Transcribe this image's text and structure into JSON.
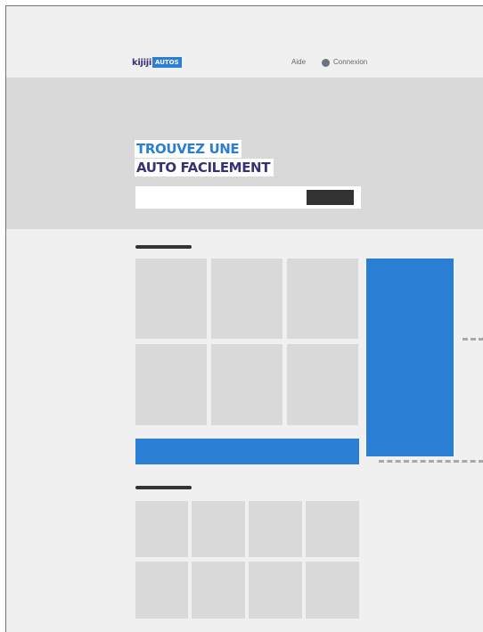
{
  "header": {
    "logo": {
      "brand": "kijiji",
      "product": "AUTOS"
    },
    "nav": {
      "help_label": "Aide",
      "login_label": "Connexion",
      "login_icon": "user-dot-icon"
    }
  },
  "hero": {
    "headline_line1": "TROUVEZ UNE",
    "headline_line2": "AUTO FACILEMENT"
  },
  "colors": {
    "brand_blue": "#2a7fd4",
    "brand_navy": "#373373",
    "placeholder_gray": "#d9d9d9",
    "page_background": "#f0f0f0",
    "dark": "#333333"
  }
}
